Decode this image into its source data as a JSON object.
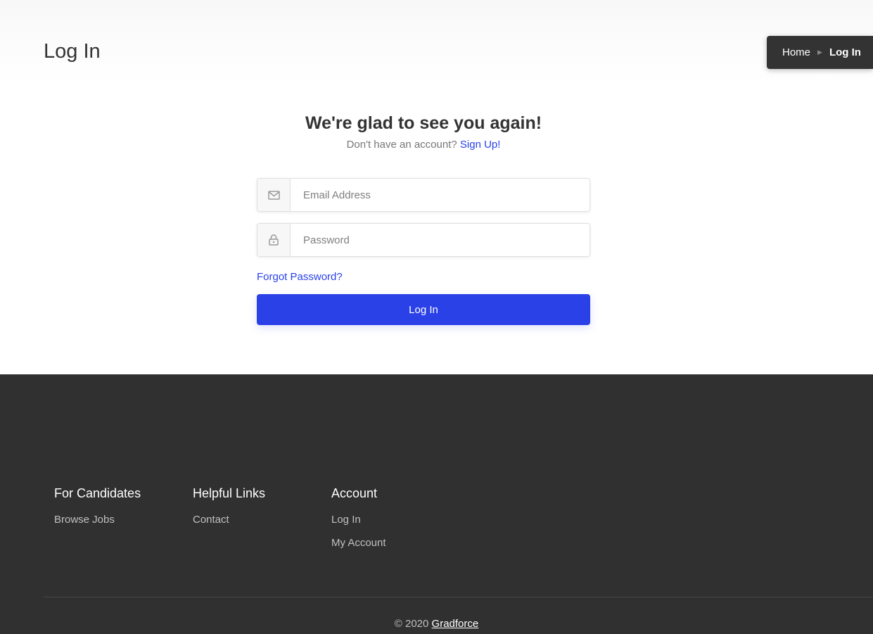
{
  "header": {
    "title": "Log In",
    "breadcrumb": {
      "home": "Home",
      "current": "Log In"
    }
  },
  "login": {
    "headline": "We're glad to see you again!",
    "subtext": "Don't have an account?",
    "signup_link": "Sign Up!",
    "email": {
      "placeholder": "Email Address",
      "value": "",
      "icon": "mail-icon"
    },
    "password": {
      "placeholder": "Password",
      "value": "",
      "icon": "lock-icon"
    },
    "forgot_link": "Forgot Password?",
    "submit_label": "Log In"
  },
  "footer": {
    "columns": [
      {
        "title": "For Candidates",
        "links": [
          "Browse Jobs"
        ]
      },
      {
        "title": "Helpful Links",
        "links": [
          "Contact"
        ]
      },
      {
        "title": "Account",
        "links": [
          "Log In",
          "My Account"
        ]
      }
    ],
    "copyright_prefix": "© 2020",
    "brand": "Gradforce"
  },
  "colors": {
    "accent": "#2a41e8",
    "dark": "#333333",
    "footer_bg": "#303030"
  }
}
